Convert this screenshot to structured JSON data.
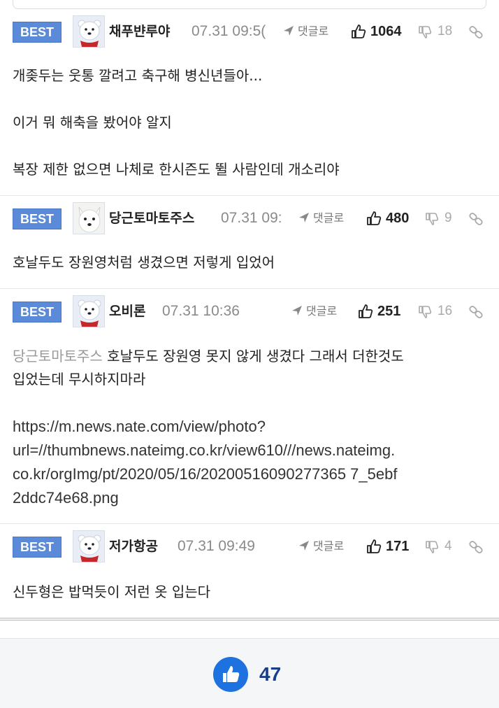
{
  "badge_label": "BEST",
  "reply_label": "댓글로",
  "comments": [
    {
      "nick": "채푸뱐루야",
      "date": "07.31 09:5(",
      "likes": "1064",
      "dislikes": "18",
      "avatar": "polar-bear",
      "lines": [
        "개좆두는 웃통 깔려고 축구해 병신년들아...",
        "이거 뭐 해축을 봤어야 알지",
        "복장 제한 없으면 나체로 한시즌도 뛸 사람인데 개소리야"
      ]
    },
    {
      "nick": "당근토마토주스",
      "date": "07.31 09:",
      "likes": "480",
      "dislikes": "9",
      "avatar": "white-dog",
      "lines": [
        "호날두도 장원영처럼 생겼으면 저렇게 입었어"
      ]
    },
    {
      "nick": "오비론",
      "date": "07.31 10:36",
      "likes": "251",
      "dislikes": "16",
      "avatar": "polar-bear",
      "mention": "당근토마토주스",
      "text_line1": "호날두도 장원영 못지 않게 생겼다 그래서 더한것도",
      "text_line2": "입었는데 무시하지마라",
      "url_lines": [
        "https://m.news.nate.com/view/photo?",
        "url=//thumbnews.nateimg.co.kr/view610///news.nateimg.",
        "co.kr/orgImg/pt/2020/05/16/20200516090277365 7_5ebf",
        "2ddc74e68.png"
      ]
    },
    {
      "nick": "저가항공",
      "date": "07.31 09:49",
      "likes": "171",
      "dislikes": "4",
      "avatar": "polar-bear",
      "lines": [
        "신두형은 밥먹듯이 저런 옷 입는다"
      ]
    }
  ],
  "footer": {
    "like_count": "47",
    "accent": "#1e72e0"
  }
}
